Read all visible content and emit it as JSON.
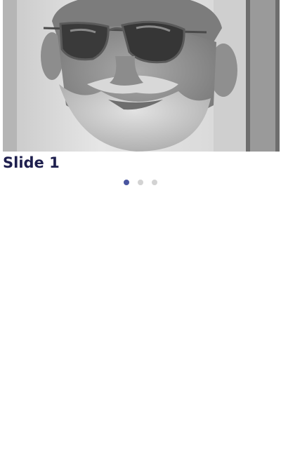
{
  "carousel": {
    "slides": [
      {
        "title": "Slide 1",
        "image": "portrait-photo"
      }
    ],
    "current_slide_title": "Slide 1",
    "dot_count": 3,
    "active_index": 0
  },
  "colors": {
    "title": "#1e1f4e",
    "dot_active": "#4a56a0",
    "dot_inactive": "#d3d3d3"
  }
}
